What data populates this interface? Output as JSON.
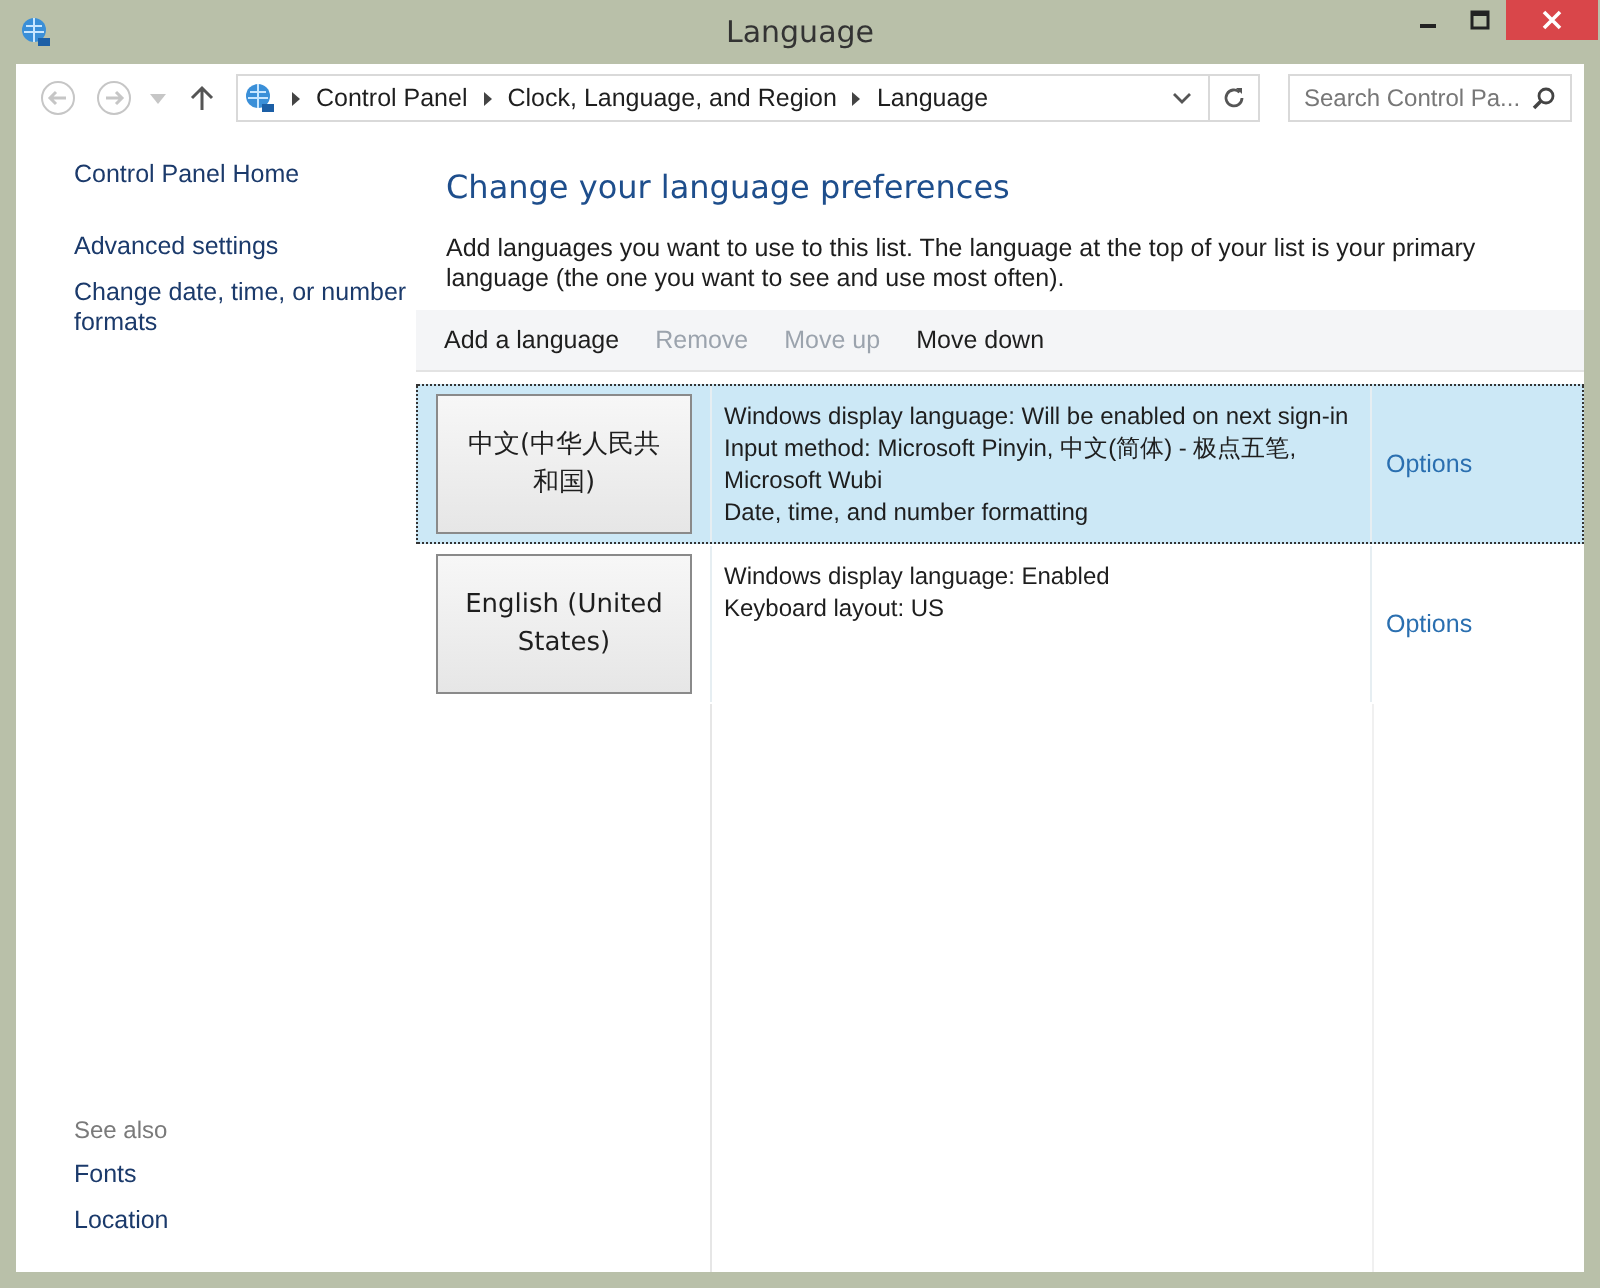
{
  "window": {
    "title": "Language"
  },
  "address_bar": {
    "crumbs": [
      "Control Panel",
      "Clock, Language, and Region",
      "Language"
    ]
  },
  "search": {
    "placeholder": "Search Control Pa..."
  },
  "sidebar": {
    "items": [
      {
        "label": "Control Panel Home"
      },
      {
        "label": "Advanced settings"
      },
      {
        "label": "Change date, time, or number formats"
      }
    ],
    "see_also": {
      "heading": "See also",
      "items": [
        {
          "label": "Fonts"
        },
        {
          "label": "Location"
        }
      ]
    }
  },
  "main": {
    "heading": "Change your language preferences",
    "intro": "Add languages you want to use to this list. The language at the top of your list is your primary language (the one you want to see and use most often).",
    "toolbar": [
      {
        "label": "Add a language",
        "disabled": false
      },
      {
        "label": "Remove",
        "disabled": true
      },
      {
        "label": "Move up",
        "disabled": true
      },
      {
        "label": "Move down",
        "disabled": false
      }
    ],
    "languages": [
      {
        "name": "中文(中华人民共和国)",
        "selected": true,
        "details": [
          "Windows display language: Will be enabled on next sign-in",
          "Input method: Microsoft Pinyin, 中文(简体) - 极点五笔, Microsoft Wubi",
          "Date, time, and number formatting"
        ],
        "options": "Options"
      },
      {
        "name": "English (United States)",
        "selected": false,
        "details": [
          "Windows display language: Enabled",
          "Keyboard layout: US"
        ],
        "options": "Options"
      }
    ]
  }
}
